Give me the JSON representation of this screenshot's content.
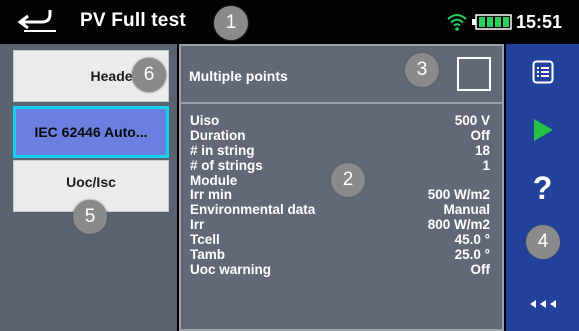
{
  "titlebar": {
    "title": "PV Full test",
    "time": "15:51",
    "battery_level": 1.0
  },
  "left_panel": {
    "items": [
      {
        "label": "Header"
      },
      {
        "label": "IEC 62446 Auto...",
        "selected": true
      },
      {
        "label": "Uoc/Isc"
      }
    ]
  },
  "center": {
    "multiple_points": {
      "label": "Multiple points",
      "checked": false
    },
    "parameters": [
      {
        "label": "Uiso",
        "value": "500 V"
      },
      {
        "label": "Duration",
        "value": "Off"
      },
      {
        "label": "# in string",
        "value": "18"
      },
      {
        "label": "# of strings",
        "value": "1"
      },
      {
        "label": "Module",
        "value": ""
      },
      {
        "label": "Irr min",
        "value": "500 W/m2"
      },
      {
        "label": "Environmental data",
        "value": "Manual"
      },
      {
        "label": "Irr",
        "value": "800 W/m2"
      },
      {
        "label": "Tcell",
        "value": "45.0 °"
      },
      {
        "label": "Tamb",
        "value": "25.0 °"
      },
      {
        "label": "Uoc warning",
        "value": "Off"
      }
    ]
  },
  "right_panel": {
    "help_label": "?"
  },
  "callouts": [
    "1",
    "2",
    "3",
    "4",
    "5",
    "6"
  ],
  "colors": {
    "right_panel": "#21419b",
    "selected_border": "#14d1ef",
    "start_arrow": "#27c244"
  }
}
